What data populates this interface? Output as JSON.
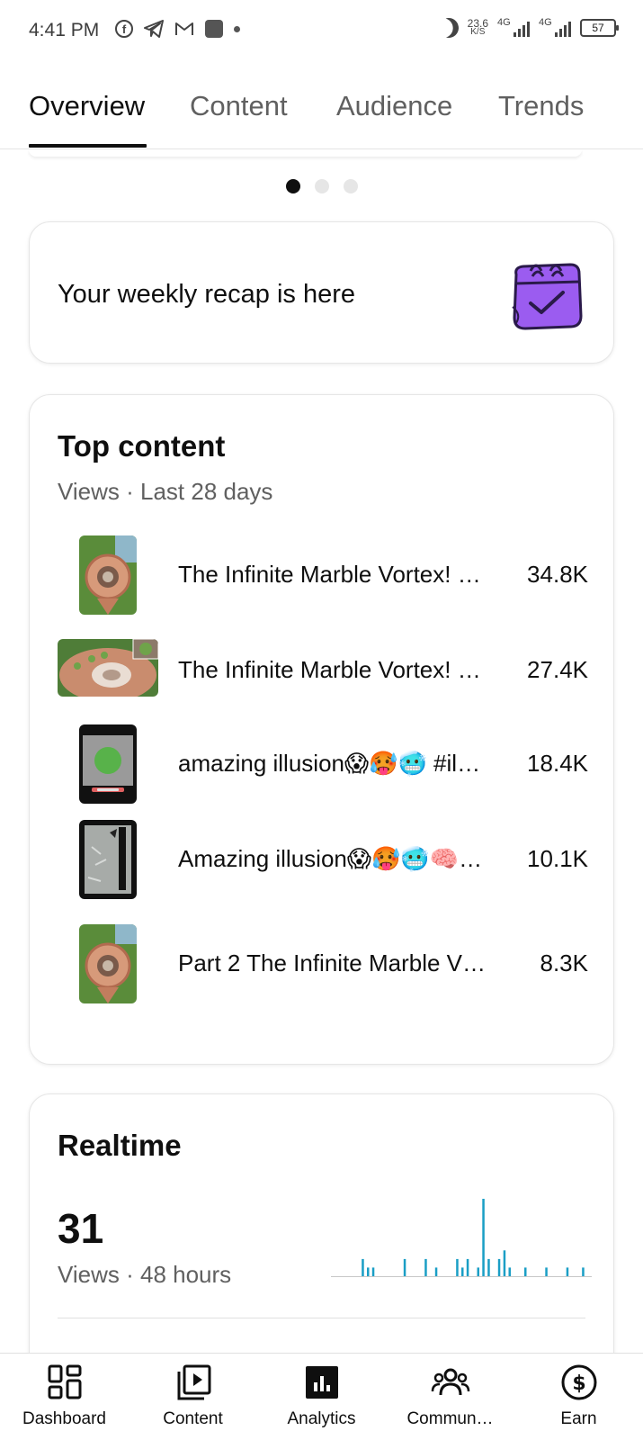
{
  "status_bar": {
    "time": "4:41 PM",
    "net_speed_value": "23.6",
    "net_speed_unit": "K/S",
    "signal1_label": "4G",
    "signal2_label": "4G",
    "battery": "57"
  },
  "tabs": [
    {
      "label": "Overview",
      "active": true
    },
    {
      "label": "Content",
      "active": false
    },
    {
      "label": "Audience",
      "active": false
    },
    {
      "label": "Trends",
      "active": false
    }
  ],
  "pager": {
    "count": 3,
    "active_index": 0
  },
  "recap": {
    "title": "Your weekly recap is here",
    "icon": "calendar-check-icon"
  },
  "top_content": {
    "title": "Top content",
    "subtitle": "Views · Last 28 days",
    "items": [
      {
        "title": "The Infinite Marble Vortex! …",
        "views": "34.8K",
        "thumb": "marble-vortex-vertical"
      },
      {
        "title": "The Infinite Marble Vortex! …",
        "views": "27.4K",
        "thumb": "marble-vortex-horizontal"
      },
      {
        "title": "amazing illusion😱🥵🥶 #il…",
        "views": "18.4K",
        "thumb": "green-circle-illusion"
      },
      {
        "title": "Amazing illusion😱🥵🥶🧠…",
        "views": "10.1K",
        "thumb": "gray-illusion"
      },
      {
        "title": "Part 2 The Infinite Marble V…",
        "views": "8.3K",
        "thumb": "marble-vortex-vertical"
      }
    ]
  },
  "realtime": {
    "title": "Realtime",
    "value": "31",
    "subtitle": "Views · 48 hours",
    "bar_color": "#1a9ec5",
    "chart_data": {
      "type": "bar",
      "hourly_views": [
        0,
        0,
        0,
        0,
        0,
        2,
        1,
        1,
        0,
        0,
        0,
        0,
        0,
        2,
        0,
        0,
        0,
        2,
        0,
        1,
        0,
        0,
        0,
        2,
        1,
        2,
        0,
        1,
        9,
        2,
        0,
        2,
        3,
        1,
        0,
        0,
        1,
        0,
        0,
        0,
        1,
        0,
        0,
        0,
        1,
        0,
        0,
        1
      ]
    }
  },
  "bottom_nav": [
    {
      "label": "Dashboard",
      "icon": "dashboard-icon",
      "active": false
    },
    {
      "label": "Content",
      "icon": "content-icon",
      "active": false
    },
    {
      "label": "Analytics",
      "icon": "analytics-icon",
      "active": true
    },
    {
      "label": "Commun…",
      "icon": "community-icon",
      "active": false
    },
    {
      "label": "Earn",
      "icon": "earn-icon",
      "active": false
    }
  ]
}
